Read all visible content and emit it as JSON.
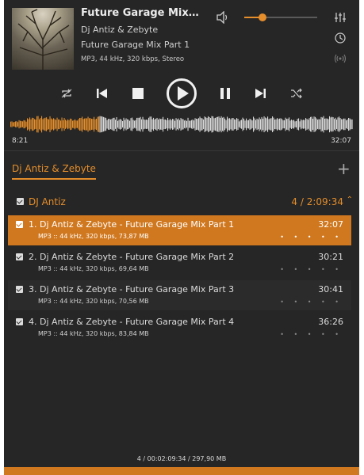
{
  "now_playing": {
    "title": "Future Garage Mix...",
    "artist": "Dj Antiz & Zebyte",
    "track": "Future Garage Mix Part 1",
    "format": "MP3, 44 kHz, 320 kbps, Stereo"
  },
  "volume": {
    "level": 0.25
  },
  "icons": {
    "volume": "speaker-icon",
    "equalizer": "equalizer-icon",
    "timer": "clock-icon",
    "broadcast": "broadcast-icon",
    "repeat": "repeat-icon",
    "previous": "previous-icon",
    "stop": "stop-icon",
    "play": "play-icon",
    "pause": "pause-icon",
    "next": "next-icon",
    "shuffle": "shuffle-icon"
  },
  "progress": {
    "elapsed": "8:21",
    "total": "32:07",
    "fraction": 0.26
  },
  "tab": {
    "label": "Dj Antiz & Zebyte",
    "add": "+"
  },
  "group": {
    "name": "DJ Antiz",
    "summary": "4 / 2:09:34",
    "chevron": "⌃"
  },
  "playlist": [
    {
      "title": "1. Dj Antiz & Zebyte - Future Garage Mix Part 1",
      "info": "MP3 :: 44 kHz, 320 kbps, 73,87 MB",
      "duration": "32:07",
      "dots": "• • • • •"
    },
    {
      "title": "2. Dj Antiz & Zebyte - Future Garage Mix Part 2",
      "info": "MP3 :: 44 kHz, 320 kbps, 69,64 MB",
      "duration": "30:21",
      "dots": "• • • • •"
    },
    {
      "title": "3. Dj Antiz & Zebyte - Future Garage Mix Part 3",
      "info": "MP3 :: 44 kHz, 320 kbps, 70,56 MB",
      "duration": "30:41",
      "dots": "• • • • •"
    },
    {
      "title": "4. Dj Antiz & Zebyte - Future Garage Mix Part 4",
      "info": "MP3 :: 44 kHz, 320 kbps, 83,84 MB",
      "duration": "36:26",
      "dots": "• • • • •"
    }
  ],
  "footer": {
    "summary": "4 / 00:02:09:34 / 297,90 MB"
  },
  "colors": {
    "accent": "#e58e2b",
    "active_row": "#d0781f",
    "background": "#262626"
  }
}
